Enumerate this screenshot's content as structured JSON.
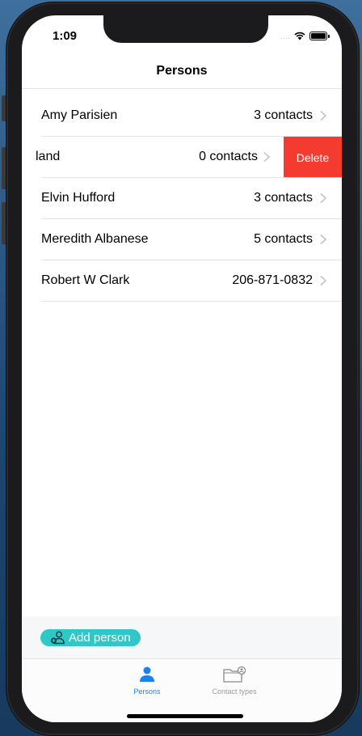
{
  "status_bar": {
    "time": "1:09",
    "signal_dots": "....",
    "wifi_icon": "wifi-icon",
    "battery_icon": "battery-icon"
  },
  "navbar": {
    "title": "Persons"
  },
  "persons": [
    {
      "name": "Amy Parisien",
      "detail": "3 contacts"
    },
    {
      "name": "land",
      "detail": "0 contacts",
      "swiped": true,
      "action": "Delete"
    },
    {
      "name": "Elvin Hufford",
      "detail": "3 contacts"
    },
    {
      "name": "Meredith Albanese",
      "detail": "5 contacts"
    },
    {
      "name": "Robert W Clark",
      "detail": "206-871-0832"
    }
  ],
  "add_person": {
    "label": "Add person",
    "icon": "person-add-icon"
  },
  "tabbar": {
    "tabs": [
      {
        "label": "Persons",
        "icon": "person-icon",
        "active": true
      },
      {
        "label": "Contact types",
        "icon": "folder-person-icon",
        "active": false
      }
    ]
  },
  "colors": {
    "delete": "#f43b30",
    "accent_teal": "#2fc7c7",
    "tab_active": "#1a82f0",
    "tab_inactive": "#9b9b9b"
  }
}
